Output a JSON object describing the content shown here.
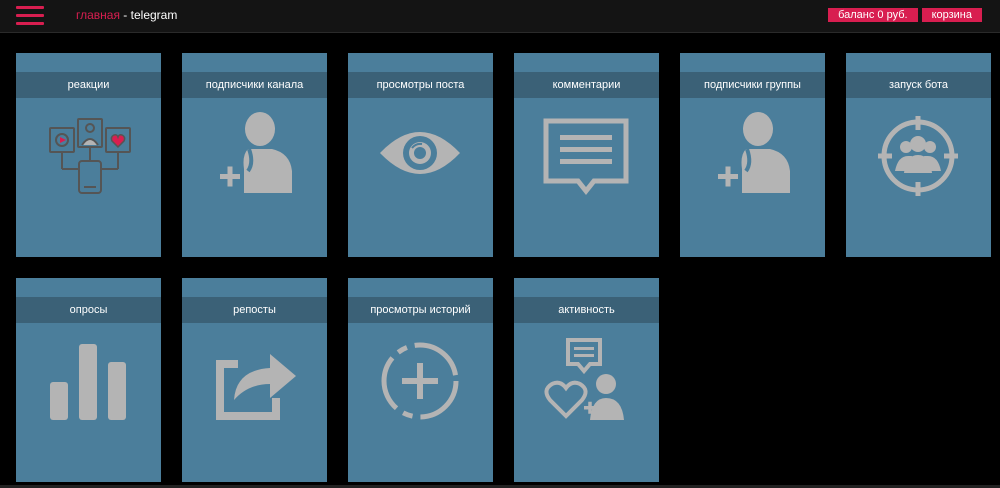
{
  "header": {
    "menu_icon": "hamburger-menu-icon",
    "breadcrumb_home": "главная",
    "breadcrumb_separator": " - ",
    "breadcrumb_current": "telegram",
    "balance_label": "баланс 0 руб.",
    "cart_label": "корзина"
  },
  "colors": {
    "accent": "#d81e50",
    "card_bg": "#4b7e9b",
    "card_title_bg": "#3b6177",
    "icon": "#b4b4b4"
  },
  "cards": [
    {
      "label": "реакции",
      "icon": "reactions-icon"
    },
    {
      "label": "подписчики канала",
      "icon": "add-user-icon"
    },
    {
      "label": "просмотры поста",
      "icon": "eye-icon"
    },
    {
      "label": "комментарии",
      "icon": "comment-icon"
    },
    {
      "label": "подписчики группы",
      "icon": "add-user-icon"
    },
    {
      "label": "запуск бота",
      "icon": "target-users-icon"
    },
    {
      "label": "опросы",
      "icon": "bar-chart-icon"
    },
    {
      "label": "репосты",
      "icon": "share-icon"
    },
    {
      "label": "просмотры историй",
      "icon": "story-plus-icon"
    },
    {
      "label": "активность",
      "icon": "activity-icon"
    }
  ]
}
